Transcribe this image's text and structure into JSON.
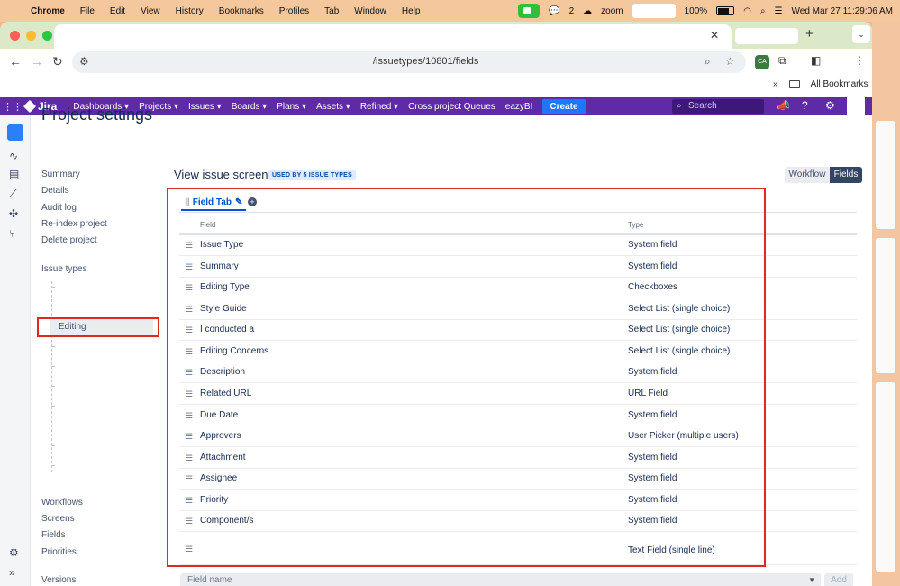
{
  "mac_menu": {
    "app": "Chrome",
    "items": [
      "File",
      "Edit",
      "View",
      "History",
      "Bookmarks",
      "Profiles",
      "Tab",
      "Window",
      "Help"
    ],
    "wechat_count": "2",
    "zoom_label": "zoom",
    "battery": "100%",
    "datetime": "Wed Mar 27  11:29:06 AM"
  },
  "browser": {
    "url": "/issuetypes/10801/fields",
    "bookmarks_label": "All Bookmarks",
    "ext_badge": "CA"
  },
  "jira_nav": {
    "logo": "Jira",
    "items": [
      "Dashboards ▾",
      "Projects ▾",
      "Issues ▾",
      "Boards ▾",
      "Plans ▾",
      "Assets ▾",
      "Refined ▾",
      "Cross project Queues",
      "eazyBI"
    ],
    "create": "Create",
    "search_placeholder": "Search"
  },
  "page": {
    "title": "Project settings",
    "sidebar_top": [
      "Summary",
      "Details",
      "Audit log",
      "Re-index project",
      "Delete project"
    ],
    "issue_types_label": "Issue types",
    "selected_issue_type": "Editing",
    "sidebar_bottom": [
      "Workflows",
      "Screens",
      "Fields",
      "Priorities",
      "Versions"
    ]
  },
  "screen": {
    "title": "View issue screen",
    "used_badge": "USED BY 5 ISSUE TYPES",
    "toggle": {
      "workflow": "Workflow",
      "fields": "Fields"
    },
    "tab_grip": "|||",
    "tab_name": "Field Tab",
    "col_field": "Field",
    "col_type": "Type",
    "rows": [
      {
        "field": "Issue Type",
        "type": "System field"
      },
      {
        "field": "Summary",
        "type": "System field"
      },
      {
        "field": "Editing Type",
        "type": "Checkboxes"
      },
      {
        "field": "Style Guide",
        "type": "Select List (single choice)"
      },
      {
        "field": "I conducted a",
        "type": "Select List (single choice)"
      },
      {
        "field": "Editing Concerns",
        "type": "Select List (single choice)"
      },
      {
        "field": "Description",
        "type": "System field"
      },
      {
        "field": "Related URL",
        "type": "URL Field"
      },
      {
        "field": "Due Date",
        "type": "System field"
      },
      {
        "field": "Approvers",
        "type": "User Picker (multiple users)"
      },
      {
        "field": "Attachment",
        "type": "System field"
      },
      {
        "field": "Assignee",
        "type": "System field"
      },
      {
        "field": "Priority",
        "type": "System field"
      },
      {
        "field": "Component/s",
        "type": "System field"
      },
      {
        "field": "",
        "type": "Text Field (single line)"
      }
    ],
    "field_name_placeholder": "Field name",
    "add_button": "Add"
  }
}
